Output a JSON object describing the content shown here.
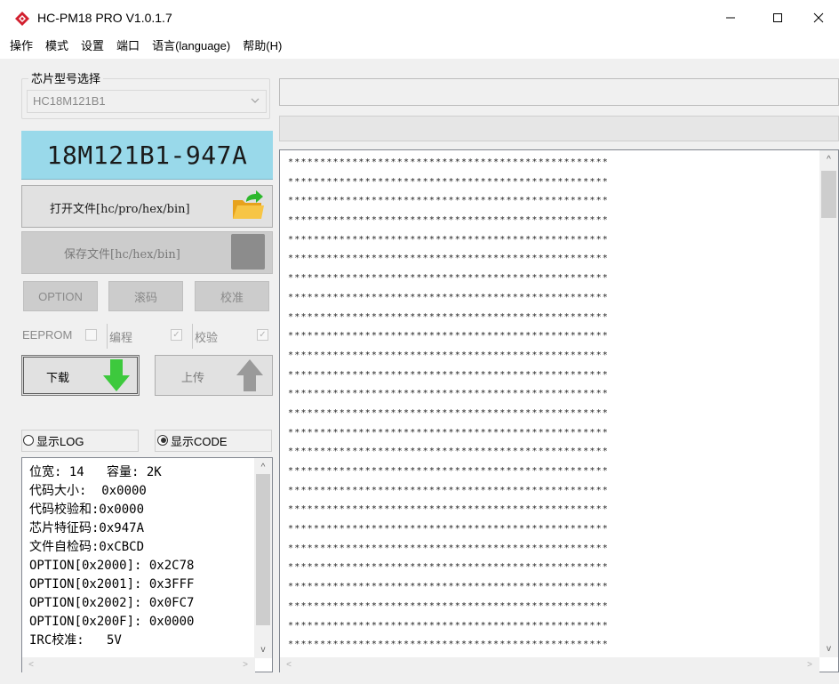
{
  "window": {
    "title": "HC-PM18 PRO V1.0.1.7",
    "controls": {
      "minimize": "—",
      "maximize": "☐",
      "close": "✕"
    }
  },
  "menu": [
    "操作",
    "模式",
    "设置",
    "端口",
    "语言(language)",
    "帮助(H)"
  ],
  "chip_select": {
    "group_label": "芯片型号选择",
    "value": "HC18M121B1"
  },
  "chip_id": "18M121B1-947A",
  "buttons": {
    "open_file": "打开文件[hc/pro/hex/bin]",
    "save_file": "保存文件[hc/hex/bin]",
    "option": "OPTION",
    "scroll_code": "滚码",
    "verify": "校准",
    "download": "下载",
    "upload": "上传"
  },
  "checkboxes": [
    {
      "label": "EEPROM",
      "checked": false
    },
    {
      "label": "编程",
      "checked": true
    },
    {
      "label": "校验",
      "checked": true
    }
  ],
  "radios": {
    "show_log": {
      "label": "显示LOG",
      "selected": false
    },
    "show_code": {
      "label": "显示CODE",
      "selected": true
    }
  },
  "info_lines": [
    "位宽: 14   容量: 2K",
    "代码大小:  0x0000",
    "代码校验和:0x0000",
    "芯片特征码:0x947A",
    "文件自检码:0xCBCD",
    "OPTION[0x2000]: 0x2C78",
    "OPTION[0x2001]: 0x3FFF",
    "OPTION[0x2002]: 0x0FC7",
    "OPTION[0x200F]: 0x0000",
    "IRC校准:   5V"
  ],
  "code_line": "**************************************************",
  "code_line_count": 26,
  "scroll_arrows": {
    "up": "^",
    "down": "v",
    "left": "<",
    "right": ">"
  },
  "colors": {
    "chip_id_bg": "#99d9ea",
    "download_arrow": "#3dc93d",
    "upload_arrow": "#9a9a9a",
    "folder": "#f5b92e",
    "folder_arrow": "#2db82d"
  }
}
